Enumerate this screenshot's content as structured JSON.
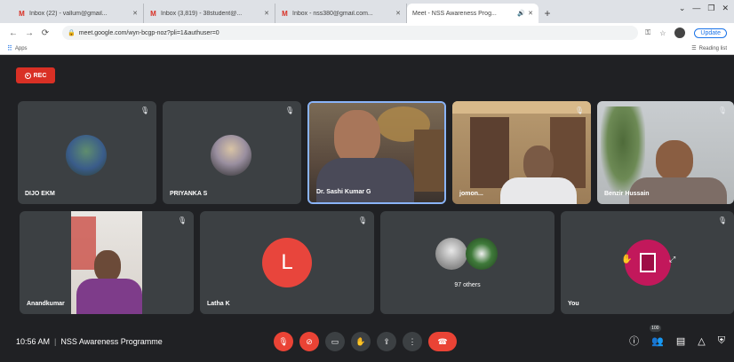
{
  "browser": {
    "tabs": [
      {
        "title": "Inbox (22) - vallum@gmail...",
        "favicon": "M"
      },
      {
        "title": "Inbox (3,819) - 38student@...",
        "favicon": "M"
      },
      {
        "title": "Inbox - nss380@gmail.com...",
        "favicon": "M"
      },
      {
        "title": "Meet - NSS Awareness Prog...",
        "favicon": "meet",
        "active": true
      }
    ],
    "url": "meet.google.com/wyn-bcgp-noz?pli=1&authuser=0",
    "update_label": "Update",
    "bookmarks_apps": "Apps",
    "reading_list": "Reading list"
  },
  "meet": {
    "rec_label": "REC",
    "participants": [
      {
        "name": "DIJO EKM",
        "type": "photo-avatar"
      },
      {
        "name": "PRIYANKA S",
        "type": "photo-avatar"
      },
      {
        "name": "Dr. Sashi Kumar G",
        "type": "video"
      },
      {
        "name": "jomon...",
        "type": "video"
      },
      {
        "name": "Benzir Hussain",
        "type": "video"
      },
      {
        "name": "Anandkumar",
        "type": "video"
      },
      {
        "name": "Latha K",
        "type": "letter-avatar",
        "letter": "L"
      },
      {
        "name": "97 others",
        "type": "others"
      },
      {
        "name": "You",
        "type": "self"
      }
    ],
    "bottom": {
      "time": "10:56 AM",
      "separator": "|",
      "meeting_name": "NSS Awareness Programme",
      "participant_count": "100"
    }
  },
  "colors": {
    "background": "#202124",
    "tile": "#3c4043",
    "red": "#ea4335",
    "letter_avatar": "#e8453c",
    "self_avatar": "#c2185b"
  }
}
